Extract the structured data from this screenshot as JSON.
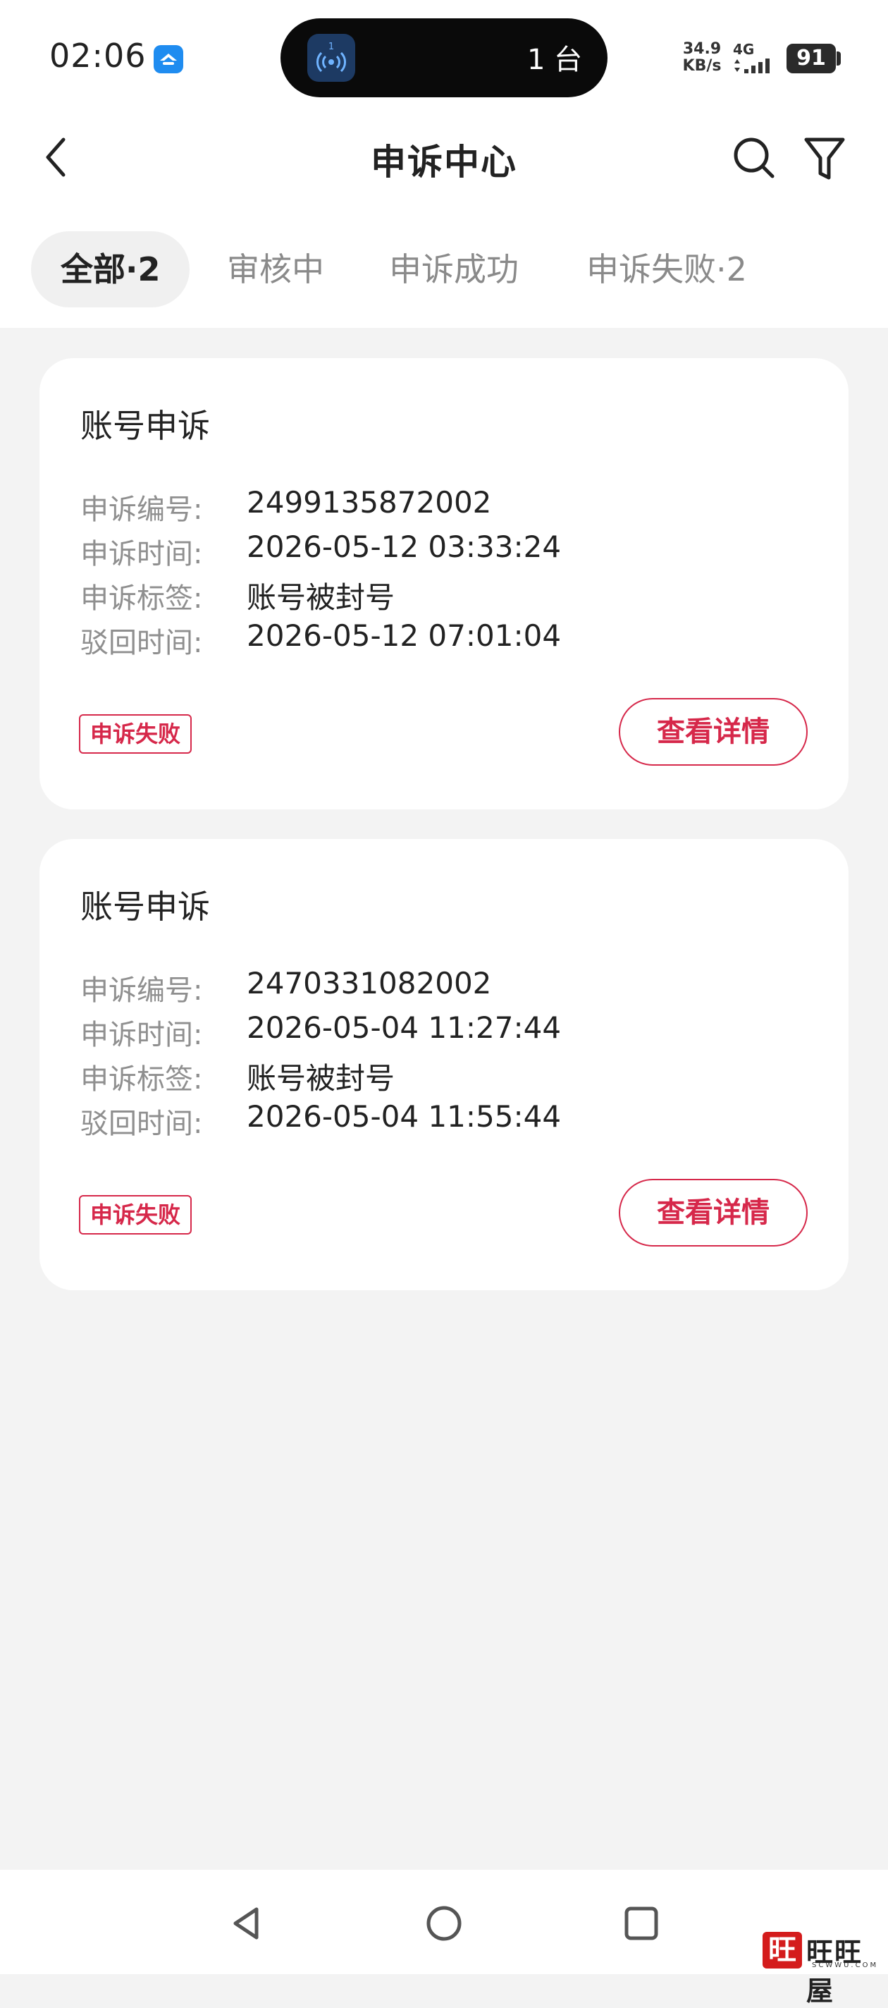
{
  "status_bar": {
    "time": "02:06",
    "island_text": "1 台",
    "island_badge_number": "1",
    "net_speed_value": "34.9",
    "net_speed_unit": "KB/s",
    "network": "4G",
    "battery": "91"
  },
  "header": {
    "title": "申诉中心"
  },
  "tabs": [
    {
      "label": "全部·2",
      "active": true
    },
    {
      "label": "审核中",
      "active": false
    },
    {
      "label": "申诉成功",
      "active": false
    },
    {
      "label": "申诉失败·2",
      "active": false
    }
  ],
  "appeals": [
    {
      "title": "账号申诉",
      "rows": [
        {
          "label": "申诉编号:",
          "value": "2499135872002"
        },
        {
          "label": "申诉时间:",
          "value": "2026-05-12 03:33:24"
        },
        {
          "label": "申诉标签:",
          "value": "账号被封号"
        },
        {
          "label": "驳回时间:",
          "value": "2026-05-12 07:01:04"
        }
      ],
      "status": "申诉失败",
      "button": "查看详情"
    },
    {
      "title": "账号申诉",
      "rows": [
        {
          "label": "申诉编号:",
          "value": "2470331082002"
        },
        {
          "label": "申诉时间:",
          "value": "2026-05-04 11:27:44"
        },
        {
          "label": "申诉标签:",
          "value": "账号被封号"
        },
        {
          "label": "驳回时间:",
          "value": "2026-05-04 11:55:44"
        }
      ],
      "status": "申诉失败",
      "button": "查看详情"
    }
  ],
  "colors": {
    "accent": "#d6284a",
    "background": "#f3f3f3",
    "card": "#ffffff"
  },
  "icons": {
    "back": "chevron-left-icon",
    "search": "search-icon",
    "filter": "filter-icon",
    "nav_back": "triangle-back-icon",
    "nav_home": "circle-home-icon",
    "nav_recents": "square-recents-icon"
  },
  "watermark": {
    "seal": "旺",
    "text": "旺旺屋",
    "sub": "SCWWU.COM"
  }
}
